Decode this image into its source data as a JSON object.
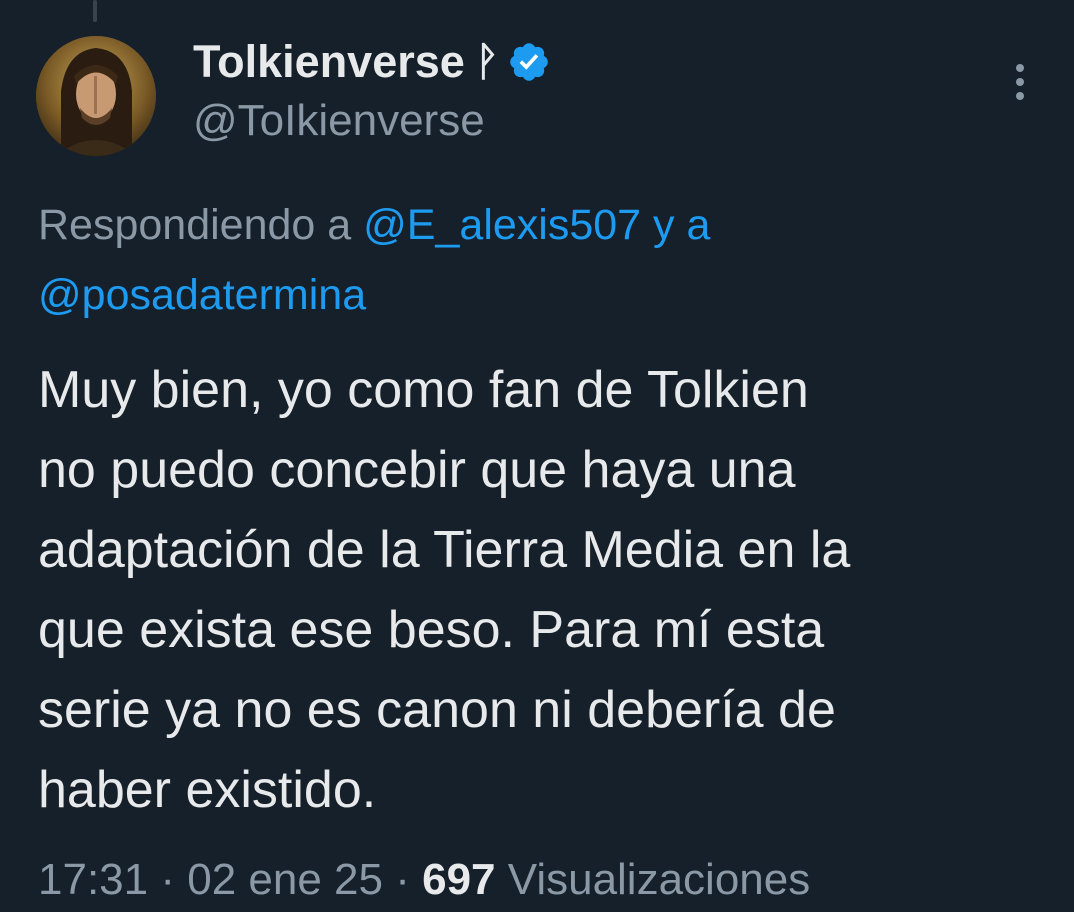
{
  "tweet": {
    "display_name": "Tolkienverse",
    "name_glyph": "ᚹ",
    "handle": "@ToIkienverse",
    "reply_prefix": "Respondiendo a",
    "reply_mention_1": "@E_alexis507",
    "reply_connector": "y a",
    "reply_mention_2": "@posadatermina",
    "text_lines": [
      "Muy bien, yo como fan de Tolkien",
      "no puedo concebir que haya una",
      "adaptación de la Tierra Media en la",
      "que exista ese beso. Para mí esta",
      "serie ya no es canon ni debería de",
      "haber existido."
    ],
    "time": "17:31",
    "separator": "·",
    "date": "02 ene 25",
    "views_count": "697",
    "views_label": "Visualizaciones"
  },
  "icons": {
    "verified": "verified-badge-icon",
    "more": "more-vertical-icon"
  },
  "colors": {
    "background": "#15202b",
    "primary_text": "#e7e9ea",
    "secondary_text": "#8b98a5",
    "accent": "#1d9bf0"
  }
}
